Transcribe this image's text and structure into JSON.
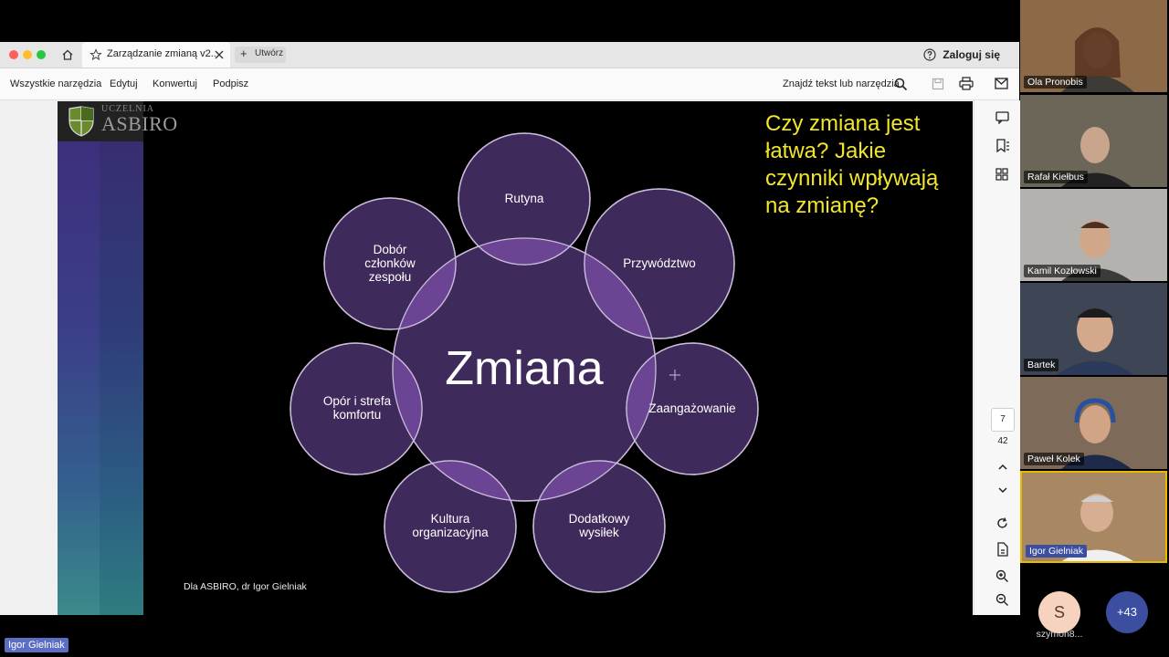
{
  "toolbar": {
    "tab_title": "Zarządzanie zmianą v2...",
    "new_tab_label": "Utwórz",
    "signin_label": "Zaloguj się"
  },
  "menu": {
    "items": [
      "Wszystkie narzędzia",
      "Edytuj",
      "Konwertuj",
      "Podpisz"
    ],
    "find_placeholder": "Znajdź tekst lub narzędzia"
  },
  "slide": {
    "brand_top": "UCZELNIA",
    "brand": "ASBIRO",
    "center_label": "Zmiana",
    "circles": [
      "Rutyna",
      "Przywództwo",
      "Zaangażowanie",
      "Dodatkowy\nwysiłek",
      "Kultura\norganizacyjna",
      "Opór i strefa\nkomfortu",
      "Dobór\nczłonków\nzespołu"
    ],
    "question": "Czy zmiana jest łatwa? Jakie czynniki wpływają na zmianę?",
    "credit": "Dla ASBIRO, dr Igor Gielniak"
  },
  "pagenav": {
    "current": "7",
    "total": "42"
  },
  "participants": [
    {
      "name": "Ola Pronobis",
      "bg": "#8c6a48"
    },
    {
      "name": "Rafał Kiełbus",
      "bg": "#6c6658"
    },
    {
      "name": "Kamil Kozłowski",
      "bg": "#b4b2ae"
    },
    {
      "name": "Bartek",
      "bg": "#3e4656"
    },
    {
      "name": "Paweł Kolek",
      "bg": "#7d6a58"
    },
    {
      "name": "Igor Gielniak",
      "bg": "#a88862"
    }
  ],
  "extra": {
    "avatar_letter": "S",
    "avatar_name": "szymon8...",
    "more_count": "+43"
  },
  "bottom_label": "Igor Gielniak",
  "colors": {
    "circle_fill": "#3f2a5c",
    "overlap": "#6b4494",
    "question": "#f2e62b",
    "accent_border": "#e7b900"
  }
}
